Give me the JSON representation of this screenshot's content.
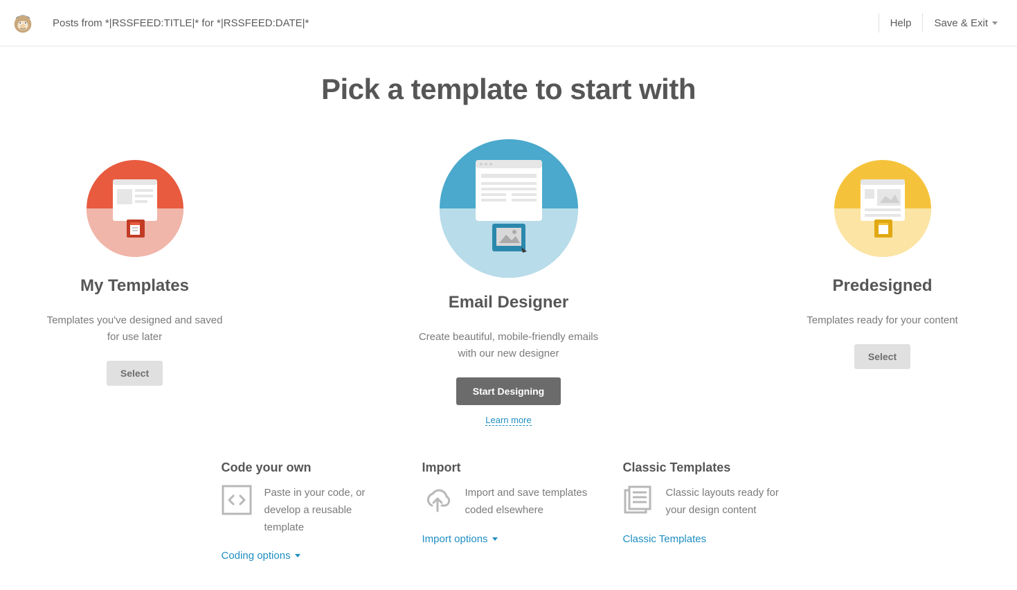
{
  "topbar": {
    "campaign_title": "Posts from *|RSSFEED:TITLE|* for *|RSSFEED:DATE|*",
    "help_label": "Help",
    "save_exit_label": "Save & Exit"
  },
  "heading": "Pick a template to start with",
  "templates": {
    "my_templates": {
      "title": "My Templates",
      "desc": "Templates you've designed and saved for use later",
      "button": "Select"
    },
    "email_designer": {
      "title": "Email Designer",
      "desc": "Create beautiful, mobile-friendly emails with our new designer",
      "button": "Start Designing",
      "learn_more": "Learn more"
    },
    "predesigned": {
      "title": "Predesigned",
      "desc": "Templates ready for your content",
      "button": "Select"
    }
  },
  "options": {
    "code": {
      "title": "Code your own",
      "desc": "Paste in your code, or develop a reusable template",
      "link": "Coding options"
    },
    "import": {
      "title": "Import",
      "desc": "Import and save templates coded elsewhere",
      "link": "Import options"
    },
    "classic": {
      "title": "Classic Templates",
      "desc": "Classic layouts ready for your design content",
      "link": "Classic Templates"
    }
  }
}
